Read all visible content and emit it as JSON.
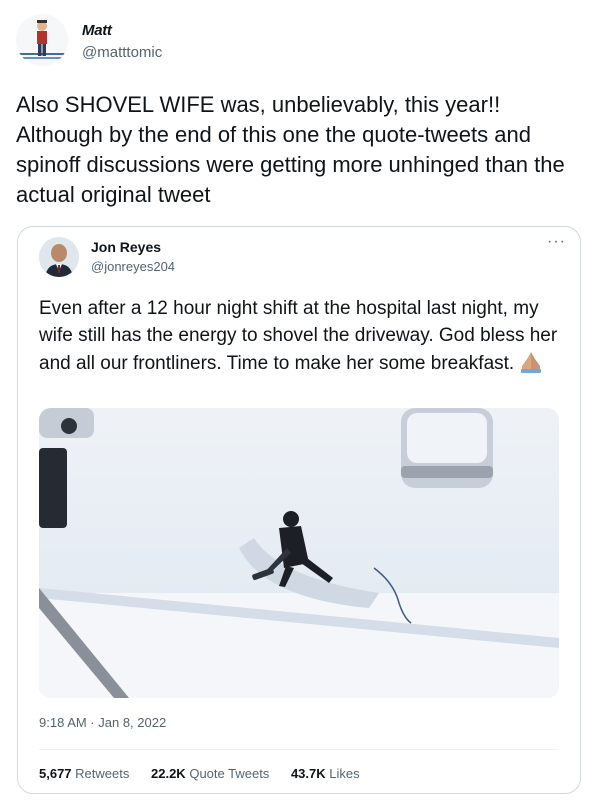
{
  "author": {
    "name": "Matt",
    "handle": "@matttomic"
  },
  "tweet": {
    "text": "Also SHOVEL WIFE was, unbelievably, this year!! Although by the end of this one the quote-tweets and spinoff discussions were getting more unhinged than the actual original tweet"
  },
  "quoted_tweet": {
    "author_name": "Jon Reyes",
    "author_handle": "@jonreyes204",
    "more_label": "···",
    "text": "Even after a 12 hour night shift at the hospital last night, my wife still has the energy to shovel the driveway. God bless her and all our frontliners. Time to make her some breakfast.",
    "emoji": "folded-hands-emoji",
    "timestamp": "9:18 AM · Jan 8, 2022",
    "stats": [
      {
        "count": "5,677",
        "label": "Retweets"
      },
      {
        "count": "22.2K",
        "label": "Quote Tweets"
      },
      {
        "count": "43.7K",
        "label": "Likes"
      }
    ]
  },
  "colors": {
    "text": "#0f1419",
    "secondary": "#536471",
    "border": "#cfd9de"
  }
}
